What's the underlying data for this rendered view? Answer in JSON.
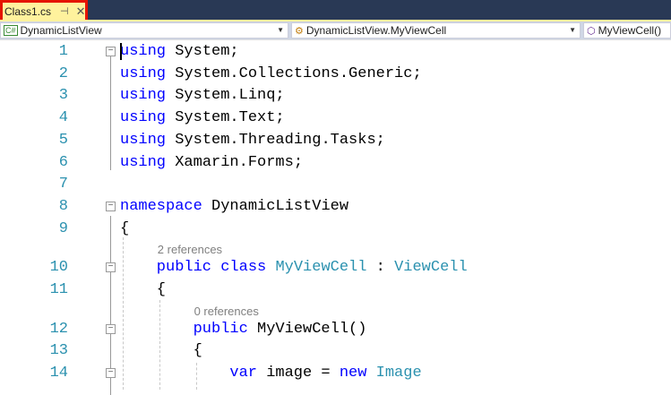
{
  "tab": {
    "title": "Class1.cs",
    "pin_icon": "pin-icon",
    "close_icon": "close-icon"
  },
  "navbar": {
    "project": "DynamicListView",
    "type": "DynamicListView.MyViewCell",
    "member": "MyViewCell()"
  },
  "colors": {
    "keyword": "#0000ff",
    "type": "#2b91af",
    "highlight_border": "#e51400",
    "tab_bg": "#fff29d"
  },
  "lines": [
    {
      "n": "1",
      "i": 0,
      "box": true,
      "t": [
        [
          "using",
          "kw"
        ],
        [
          " System;",
          ""
        ]
      ]
    },
    {
      "n": "2",
      "i": 0,
      "t": [
        [
          "using",
          "kw"
        ],
        [
          " System.Collections.Generic;",
          ""
        ]
      ]
    },
    {
      "n": "3",
      "i": 0,
      "t": [
        [
          "using",
          "kw"
        ],
        [
          " System.Linq;",
          ""
        ]
      ]
    },
    {
      "n": "4",
      "i": 0,
      "t": [
        [
          "using",
          "kw"
        ],
        [
          " System.Text;",
          ""
        ]
      ]
    },
    {
      "n": "5",
      "i": 0,
      "t": [
        [
          "using",
          "kw"
        ],
        [
          " System.Threading.Tasks;",
          ""
        ]
      ]
    },
    {
      "n": "6",
      "i": 0,
      "t": [
        [
          "using",
          "kw"
        ],
        [
          " Xamarin.Forms;",
          ""
        ]
      ]
    },
    {
      "n": "7",
      "i": 0,
      "t": []
    },
    {
      "n": "8",
      "i": 0,
      "box": true,
      "t": [
        [
          "namespace",
          "kw"
        ],
        [
          " DynamicListView",
          ""
        ]
      ]
    },
    {
      "n": "9",
      "i": 0,
      "t": [
        [
          "{",
          ""
        ]
      ]
    },
    {
      "ref": "2 references",
      "i": 1
    },
    {
      "n": "10",
      "i": 1,
      "box": true,
      "t": [
        [
          "public",
          "kw"
        ],
        [
          " ",
          ""
        ],
        [
          "class",
          "kw"
        ],
        [
          " ",
          ""
        ],
        [
          "MyViewCell",
          "ty"
        ],
        [
          " : ",
          ""
        ],
        [
          "ViewCell",
          "ty"
        ]
      ]
    },
    {
      "n": "11",
      "i": 1,
      "t": [
        [
          "{",
          ""
        ]
      ]
    },
    {
      "ref": "0 references",
      "i": 2
    },
    {
      "n": "12",
      "i": 2,
      "box": true,
      "t": [
        [
          "public",
          "kw"
        ],
        [
          " MyViewCell()",
          ""
        ]
      ]
    },
    {
      "n": "13",
      "i": 2,
      "t": [
        [
          "{",
          ""
        ]
      ]
    },
    {
      "n": "14",
      "i": 3,
      "box": true,
      "t": [
        [
          "var",
          "kw"
        ],
        [
          " image = ",
          ""
        ],
        [
          "new",
          "kw"
        ],
        [
          " ",
          ""
        ],
        [
          "Image",
          "ty"
        ]
      ]
    }
  ]
}
